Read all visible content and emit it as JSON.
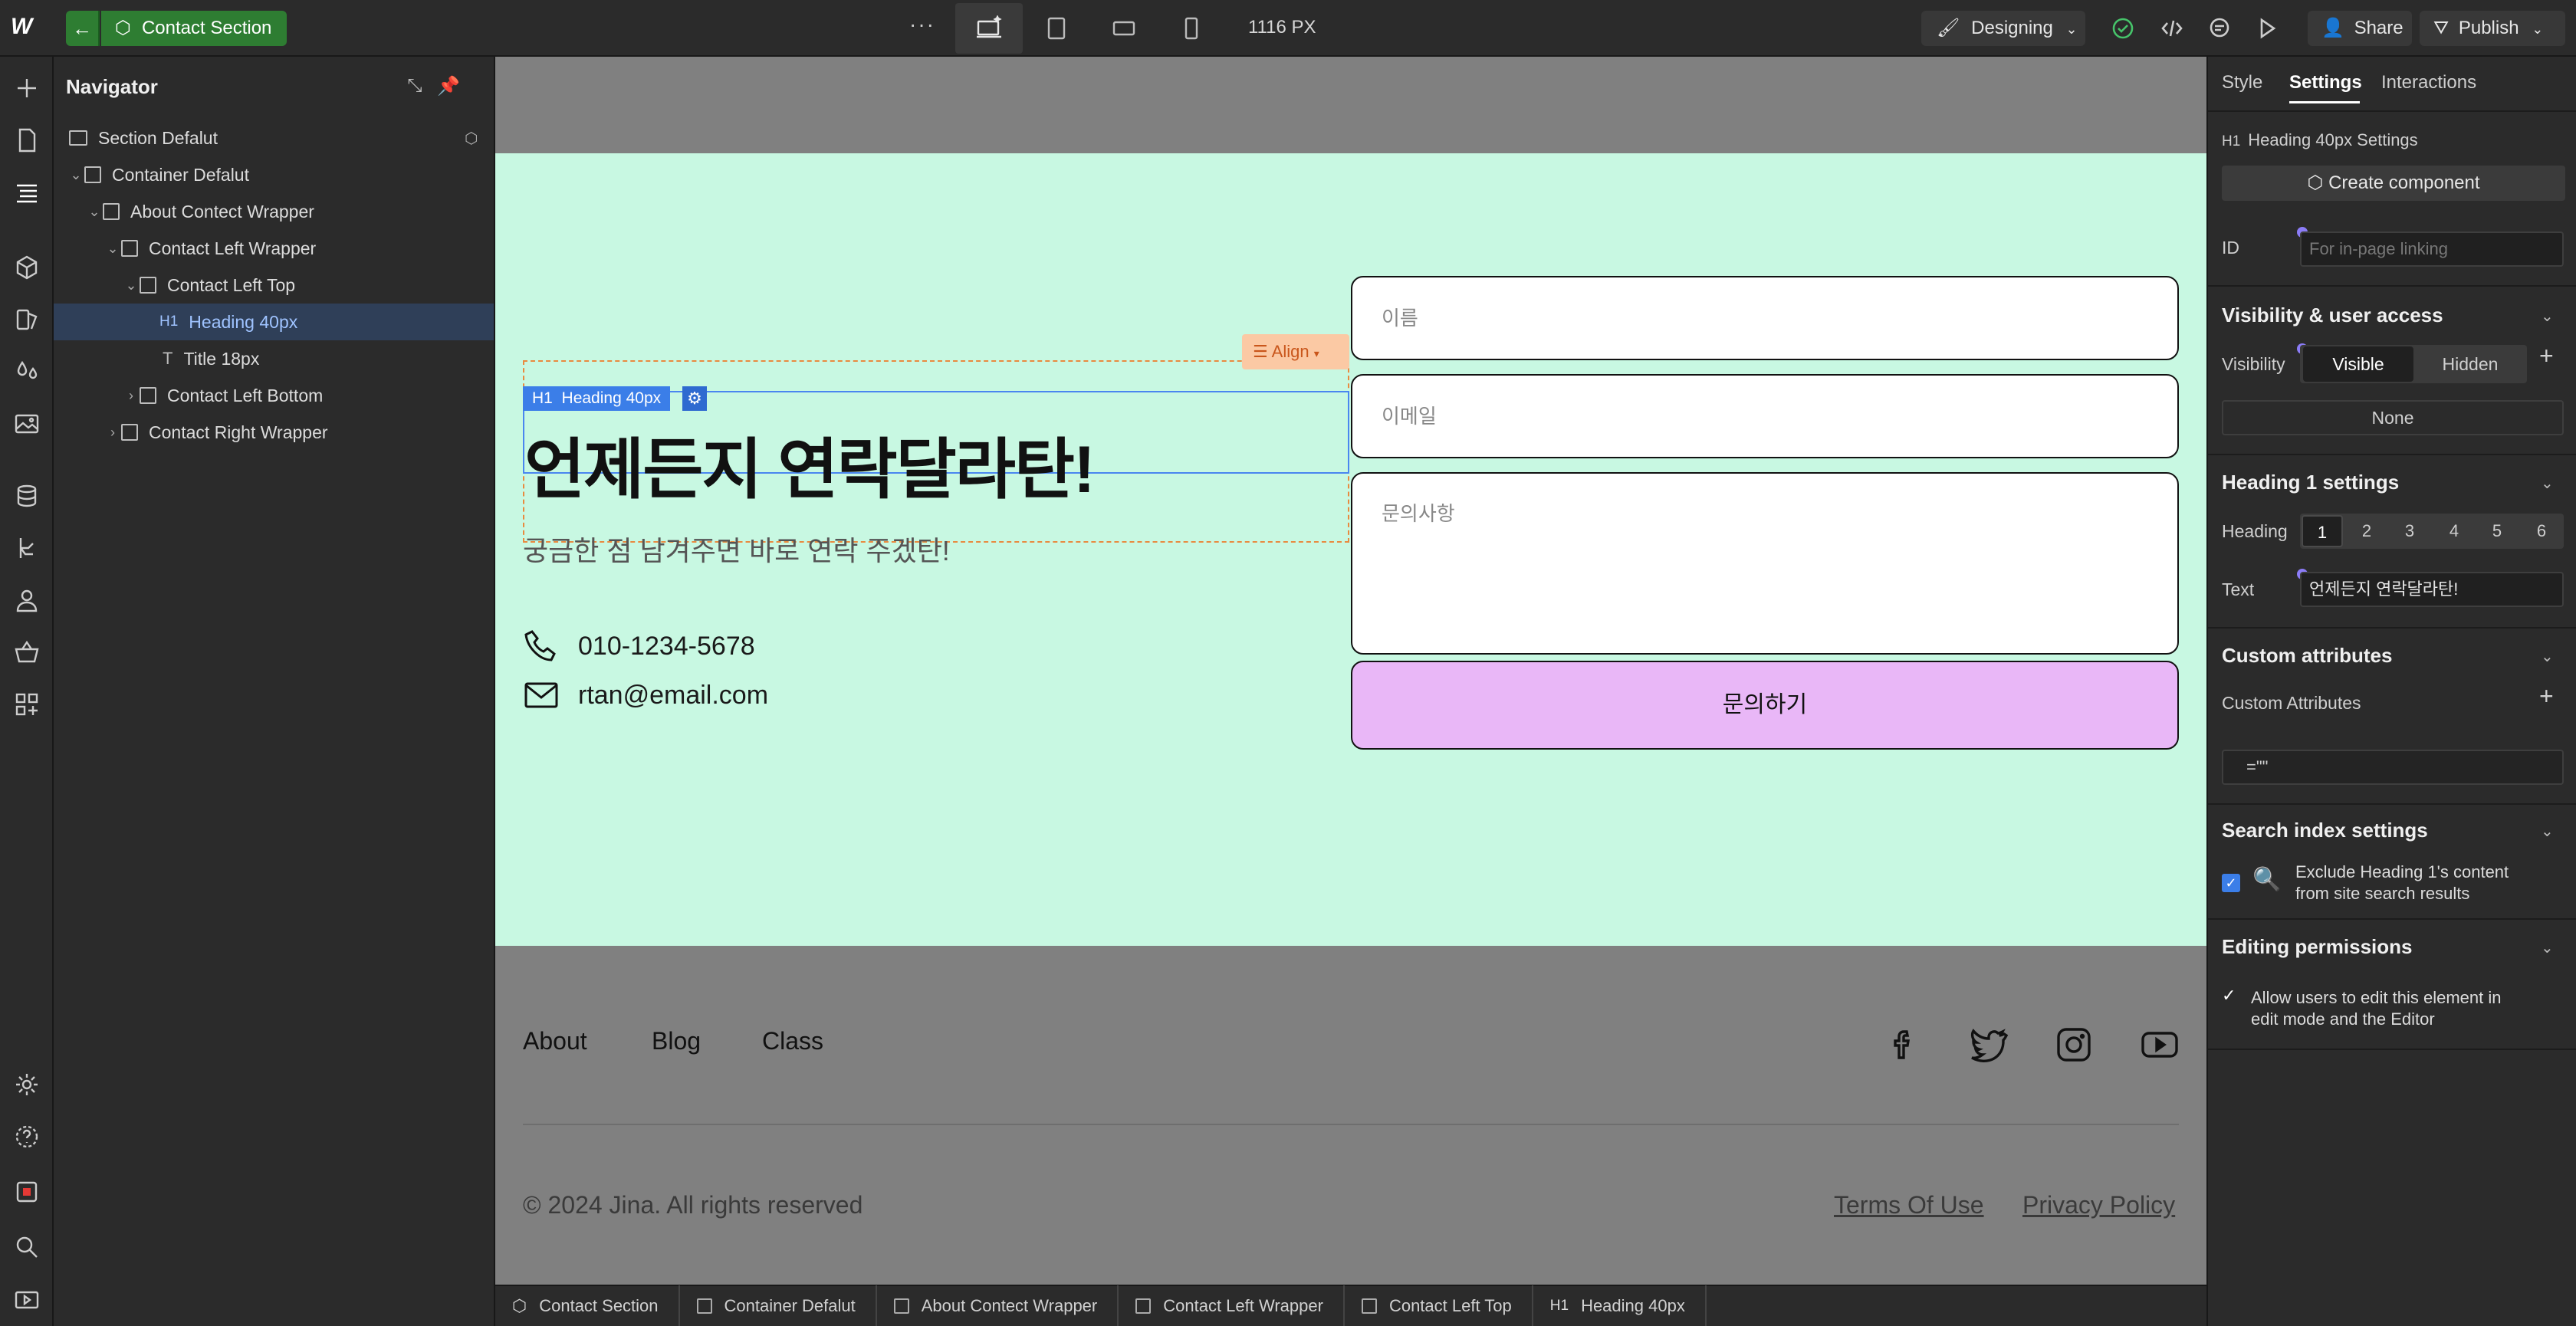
{
  "topbar": {
    "logo": "W",
    "back_icon": "arrow-left-icon",
    "context_label": "Contact Section",
    "breakpoint_width": "1116 PX",
    "mode_label": "Designing",
    "share_label": "Share",
    "publish_label": "Publish"
  },
  "navigator": {
    "title": "Navigator",
    "items": [
      {
        "label": "Section Defalut",
        "depth": 0,
        "type": "section"
      },
      {
        "label": "Container Defalut",
        "depth": 0,
        "type": "container"
      },
      {
        "label": "About Contect Wrapper",
        "depth": 1,
        "type": "div"
      },
      {
        "label": "Contact Left Wrapper",
        "depth": 2,
        "type": "div"
      },
      {
        "label": "Contact Left Top",
        "depth": 3,
        "type": "div"
      },
      {
        "label": "Heading 40px",
        "depth": 4,
        "type": "h1",
        "tag": "H1"
      },
      {
        "label": "Title 18px",
        "depth": 4,
        "type": "text",
        "tag": "T"
      },
      {
        "label": "Contact Left Bottom",
        "depth": 3,
        "type": "div"
      },
      {
        "label": "Contact Right Wrapper",
        "depth": 2,
        "type": "div"
      }
    ]
  },
  "canvas": {
    "heading_label": "Heading 40px",
    "heading_tag": "H1",
    "align_label": "Align",
    "heading": "언제든지 연락달라탄!",
    "subtitle": "궁금한 점 남겨주면 바로 연락 주겠탄!",
    "phone": "010-1234-5678",
    "email": "rtan@email.com",
    "name_placeholder": "이름",
    "email_placeholder": "이메일",
    "inquiry_placeholder": "문의사항",
    "submit_label": "문의하기",
    "footer_links": [
      "About",
      "Blog",
      "Class"
    ],
    "copyright": "© 2024 Jina. All rights reserved",
    "terms": "Terms Of Use",
    "privacy": "Privacy Policy",
    "colors": {
      "section_bg": "#c8f8e2",
      "button_bg": "#e9b7f7"
    }
  },
  "breadcrumbs": [
    {
      "label": "Contact Section",
      "type": "component"
    },
    {
      "label": "Container Defalut",
      "type": "container"
    },
    {
      "label": "About Contect Wrapper",
      "type": "div"
    },
    {
      "label": "Contact Left Wrapper",
      "type": "div"
    },
    {
      "label": "Contact Left Top",
      "type": "div"
    },
    {
      "label": "Heading 40px",
      "type": "h1",
      "tag": "H1"
    }
  ],
  "settings": {
    "tabs": [
      "Style",
      "Settings",
      "Interactions"
    ],
    "active_tab": "Settings",
    "element_tag": "H1",
    "element_title": "Heading 40px Settings",
    "create_component": "Create component",
    "id_label": "ID",
    "id_placeholder": "For in-page linking",
    "visibility_section": "Visibility & user access",
    "visibility_label": "Visibility",
    "visible": "Visible",
    "hidden": "Hidden",
    "none_label": "None",
    "heading_section": "Heading 1 settings",
    "heading_label": "Heading",
    "heading_levels": [
      "1",
      "2",
      "3",
      "4",
      "5",
      "6"
    ],
    "text_label": "Text",
    "text_value": "언제든지 연락달라탄!",
    "custom_attr_section": "Custom attributes",
    "custom_attr_label": "Custom Attributes",
    "custom_attr_value": "=\"\"",
    "search_section": "Search index settings",
    "exclude_label_1": "Exclude Heading 1's content",
    "exclude_label_2": "from site search results",
    "editing_section": "Editing permissions",
    "allow_label_1": "Allow users to edit this element in",
    "allow_label_2": "edit mode and the Editor"
  }
}
